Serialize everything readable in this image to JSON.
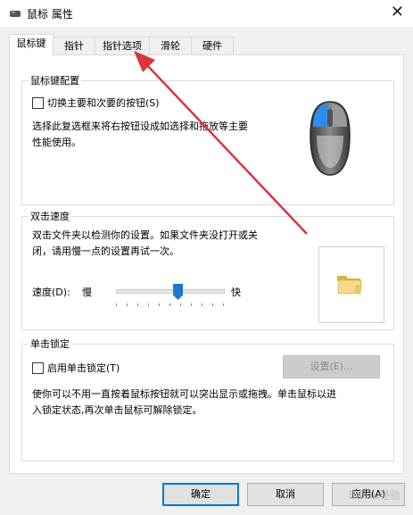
{
  "window": {
    "title": "鼠标 属性",
    "close_icon": "close-icon"
  },
  "tabs": [
    {
      "label": "鼠标键",
      "active": true
    },
    {
      "label": "指针"
    },
    {
      "label": "指针选项"
    },
    {
      "label": "滑轮"
    },
    {
      "label": "硬件"
    }
  ],
  "button_config": {
    "title": "鼠标键配置",
    "switch_checkbox_label": "切换主要和次要的按钮(S)",
    "switch_checked": false,
    "description_line1": "选择此复选框来将右按钮设成如选择和拖放等主要",
    "description_line2": "性能使用。",
    "mouse_icon": "mouse-icon"
  },
  "double_click": {
    "title": "双击速度",
    "description_line1": "双击文件夹以检测你的设置。如果文件夹没打开或关",
    "description_line2": "闭，请用慢一点的设置再试一次。",
    "speed_label": "速度(D):",
    "slow_label": "慢",
    "fast_label": "快",
    "speed_value_fraction": 0.58,
    "folder_icon": "folder-icon"
  },
  "click_lock": {
    "title": "单击锁定",
    "checkbox_label": "启用单击锁定(T)",
    "checked": false,
    "settings_button": "设置(E)...",
    "description_line1": "使你可以不用一直按着鼠标按钮就可以突出显示或拖拽。单击鼠标以进",
    "description_line2": "入锁定状态,再次单击鼠标可解除锁定。"
  },
  "footer": {
    "ok": "确定",
    "cancel": "取消",
    "apply": "应用(A)"
  },
  "annotation": {
    "arrow_color": "#d9363e"
  },
  "watermark": "Baidu经验"
}
